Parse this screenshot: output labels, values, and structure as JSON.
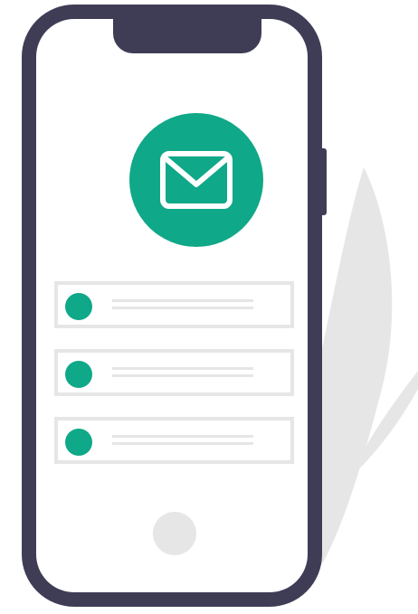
{
  "illustration": {
    "subject": "mobile-phone-email-notifications",
    "icons": {
      "badge": "envelope-icon",
      "home": "home-button"
    },
    "notification_count": 3,
    "notifications": [
      {
        "icon": "dot-icon"
      },
      {
        "icon": "dot-icon"
      },
      {
        "icon": "dot-icon"
      }
    ],
    "colors": {
      "phone_frame": "#3f3d56",
      "accent": "#0fa888",
      "neutral": "#e6e6e6",
      "screen": "#ffffff"
    }
  }
}
